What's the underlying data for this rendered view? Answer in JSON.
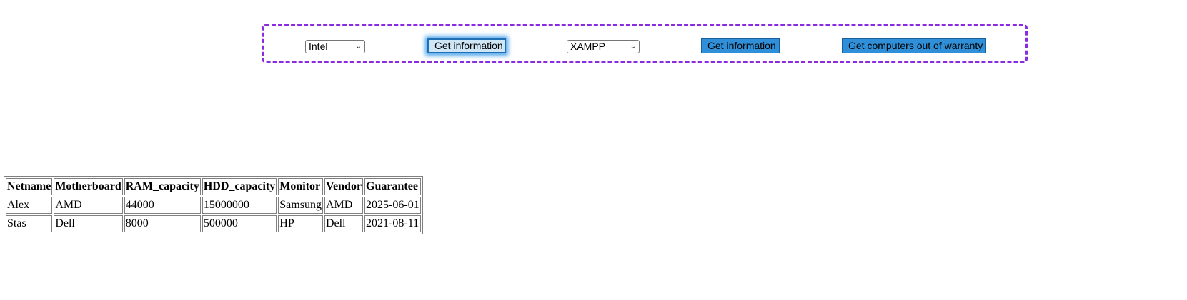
{
  "controls": {
    "processor_select": {
      "selected": "Intel"
    },
    "info_button_1": {
      "label": "Get information"
    },
    "server_select": {
      "selected": "XAMPP"
    },
    "info_button_2": {
      "label": "Get information"
    },
    "warranty_button": {
      "label": "Get computers out of warranty"
    }
  },
  "table": {
    "headers": [
      "Netname",
      "Motherboard",
      "RAM_capacity",
      "HDD_capacity",
      "Monitor",
      "Vendor",
      "Guarantee"
    ],
    "rows": [
      [
        "Alex",
        "AMD",
        "44000",
        "15000000",
        "Samsung",
        "AMD",
        "2025-06-01"
      ],
      [
        "Stas",
        "Dell",
        "8000",
        "500000",
        "HP",
        "Dell",
        "2021-08-11"
      ]
    ]
  },
  "colors": {
    "panel_border": "#8a2be2",
    "button_bg": "#2f8fd8",
    "focus_glow": "#4aa3ec"
  }
}
